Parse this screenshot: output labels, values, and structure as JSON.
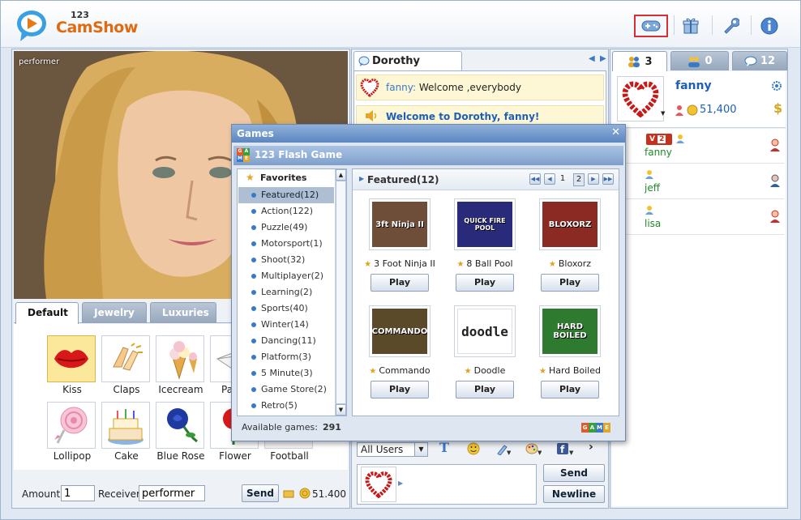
{
  "app": {
    "logo_num": "123",
    "logo_name": "CamShow"
  },
  "header": {
    "buttons": [
      "games",
      "gift",
      "settings",
      "info"
    ]
  },
  "video": {
    "label": "performer"
  },
  "gift_tabs": [
    "Default",
    "Jewelry",
    "Luxuries"
  ],
  "gifts": [
    "Kiss",
    "Claps",
    "Icecream",
    "Paper",
    "Lollipop",
    "Cake",
    "Blue Rose",
    "Flower",
    "Football"
  ],
  "send_bar": {
    "amount_label": "Amount",
    "amount_value": "1",
    "receiver_label": "Receiver",
    "receiver_value": "performer",
    "send": "Send",
    "coins": "51.400"
  },
  "chat": {
    "tab": "Dorothy",
    "msg1_name": "fanny:",
    "msg1_text": " Welcome ,everybody",
    "msg2_text": "Welcome to Dorothy, fanny!",
    "audience": "All Users",
    "send": "Send",
    "newline": "Newline"
  },
  "right": {
    "tabs": [
      "3",
      "0",
      "12"
    ],
    "me_name": "fanny",
    "me_coins": "51,400",
    "vip_level": "2",
    "users": [
      "fanny",
      "jeff",
      "lisa"
    ]
  },
  "games_dialog": {
    "title": "Games",
    "subtitle": "123 Flash Game",
    "favorites": "Favorites",
    "categories": [
      "Featured(12)",
      "Action(122)",
      "Puzzle(49)",
      "Motorsport(1)",
      "Shoot(32)",
      "Multiplayer(2)",
      "Learning(2)",
      "Sports(40)",
      "Winter(14)",
      "Dancing(11)",
      "Platform(3)",
      "5 Minute(3)",
      "Game Store(2)",
      "Retro(5)"
    ],
    "pane_title": "Featured(12)",
    "pages": [
      "1",
      "2"
    ],
    "games": [
      {
        "name": "3 Foot Ninja II",
        "thumb": "3ft Ninja II",
        "color": "#6e4e38"
      },
      {
        "name": "8 Ball Pool",
        "thumb": "QUICK FIRE POOL",
        "color": "#2a2a7a"
      },
      {
        "name": "Bloxorz",
        "thumb": "BLOXORZ",
        "color": "#8a2a22"
      },
      {
        "name": "Commando",
        "thumb": "COMMANDO",
        "color": "#5a4a2a"
      },
      {
        "name": "Doodle",
        "thumb": "doodle",
        "color": "#ffffff"
      },
      {
        "name": "Hard Boiled",
        "thumb": "HARD BOILED",
        "color": "#2e7a2e"
      }
    ],
    "play_label": "Play",
    "available_label": "Available games:",
    "available_count": "291",
    "logo_letters": [
      "G",
      "A",
      "M",
      "E"
    ]
  }
}
